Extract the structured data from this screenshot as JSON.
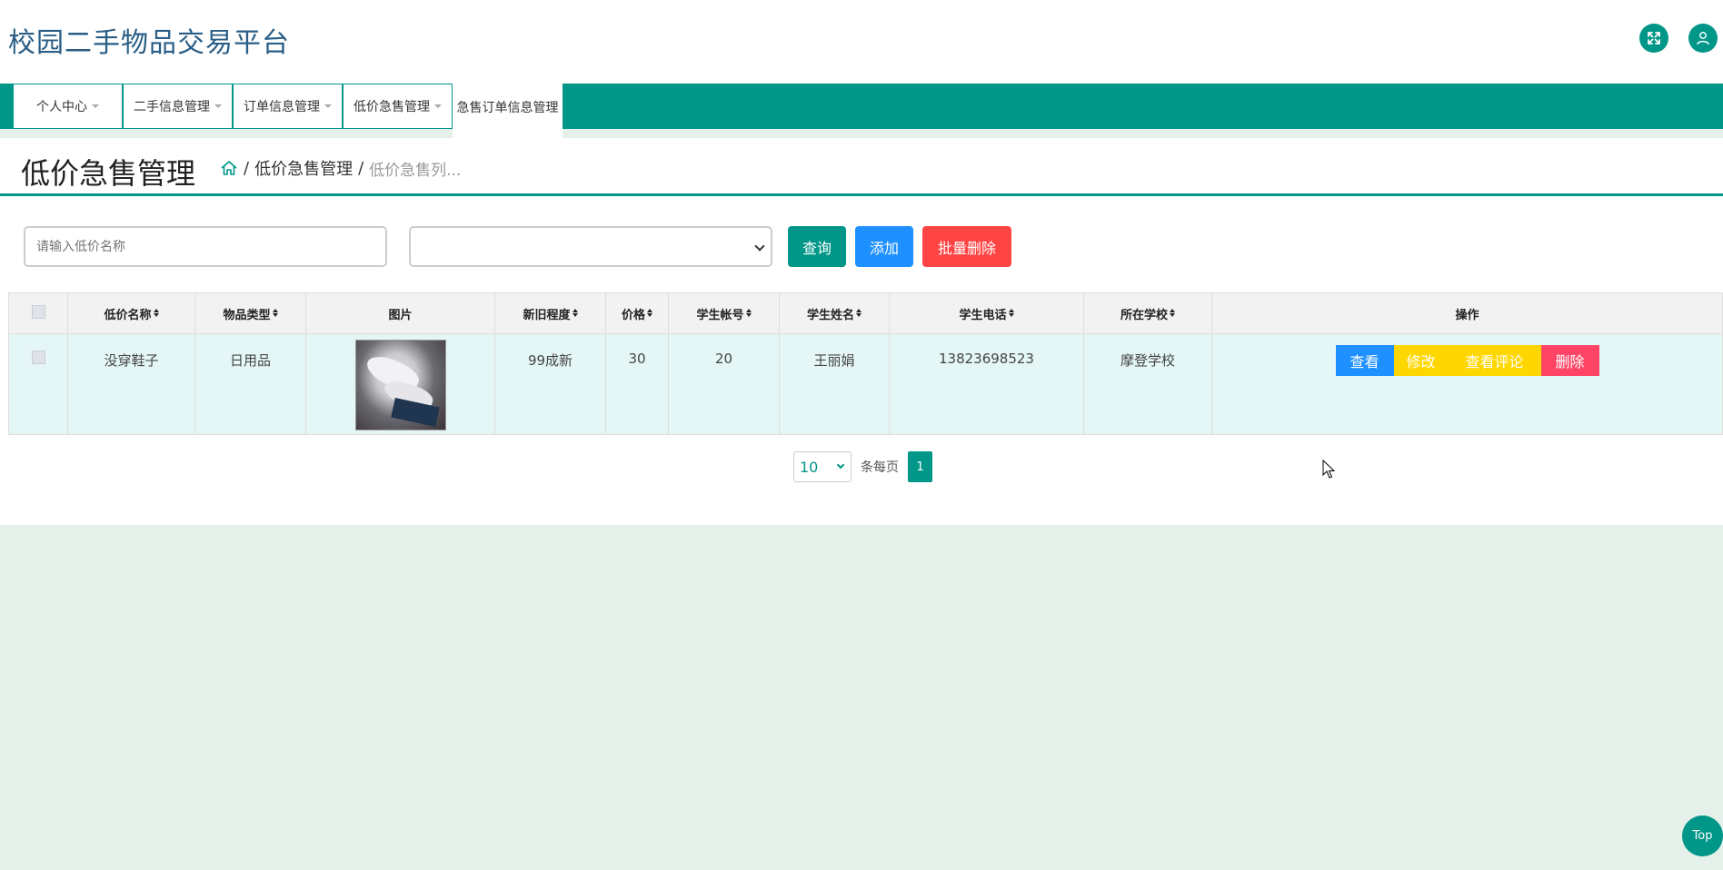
{
  "header": {
    "app_title": "校园二手物品交易平台",
    "icons": {
      "expand": "expand-icon",
      "user": "user-icon"
    }
  },
  "nav": {
    "items": [
      {
        "label": "个人中心"
      },
      {
        "label": "二手信息管理"
      },
      {
        "label": "订单信息管理"
      },
      {
        "label": "低价急售管理"
      },
      {
        "label": "急售订单信息管理"
      }
    ]
  },
  "page": {
    "title": "低价急售管理",
    "breadcrumb": {
      "sep1": "/",
      "level1": "低价急售管理",
      "sep2": "/",
      "level2": "低价急售列..."
    }
  },
  "search": {
    "name_placeholder": "请输入低价名称",
    "select_value": "",
    "query_label": "查询",
    "add_label": "添加",
    "batch_delete_label": "批量删除"
  },
  "table": {
    "headers": {
      "name": "低价名称",
      "type": "物品类型",
      "image": "图片",
      "condition": "新旧程度",
      "price": "价格",
      "student_account": "学生帐号",
      "student_name": "学生姓名",
      "student_phone": "学生电话",
      "school": "所在学校",
      "actions": "操作"
    },
    "rows": [
      {
        "name": "没穿鞋子",
        "type": "日用品",
        "condition": "99成新",
        "price": "30",
        "student_account": "20",
        "student_name": "王丽娟",
        "student_phone": "13823698523",
        "school": "摩登学校",
        "actions": {
          "view": "查看",
          "edit": "修改",
          "comment": "查看评论",
          "delete": "删除"
        }
      }
    ]
  },
  "pagination": {
    "page_size": "10",
    "page_size_label": "条每页",
    "current_page": "1"
  },
  "back_to_top": "Top",
  "colors": {
    "primary": "#009688",
    "blue": "#1e90ff",
    "yellow": "#ffd700",
    "red": "#ff4466",
    "title": "#2a5e86"
  }
}
